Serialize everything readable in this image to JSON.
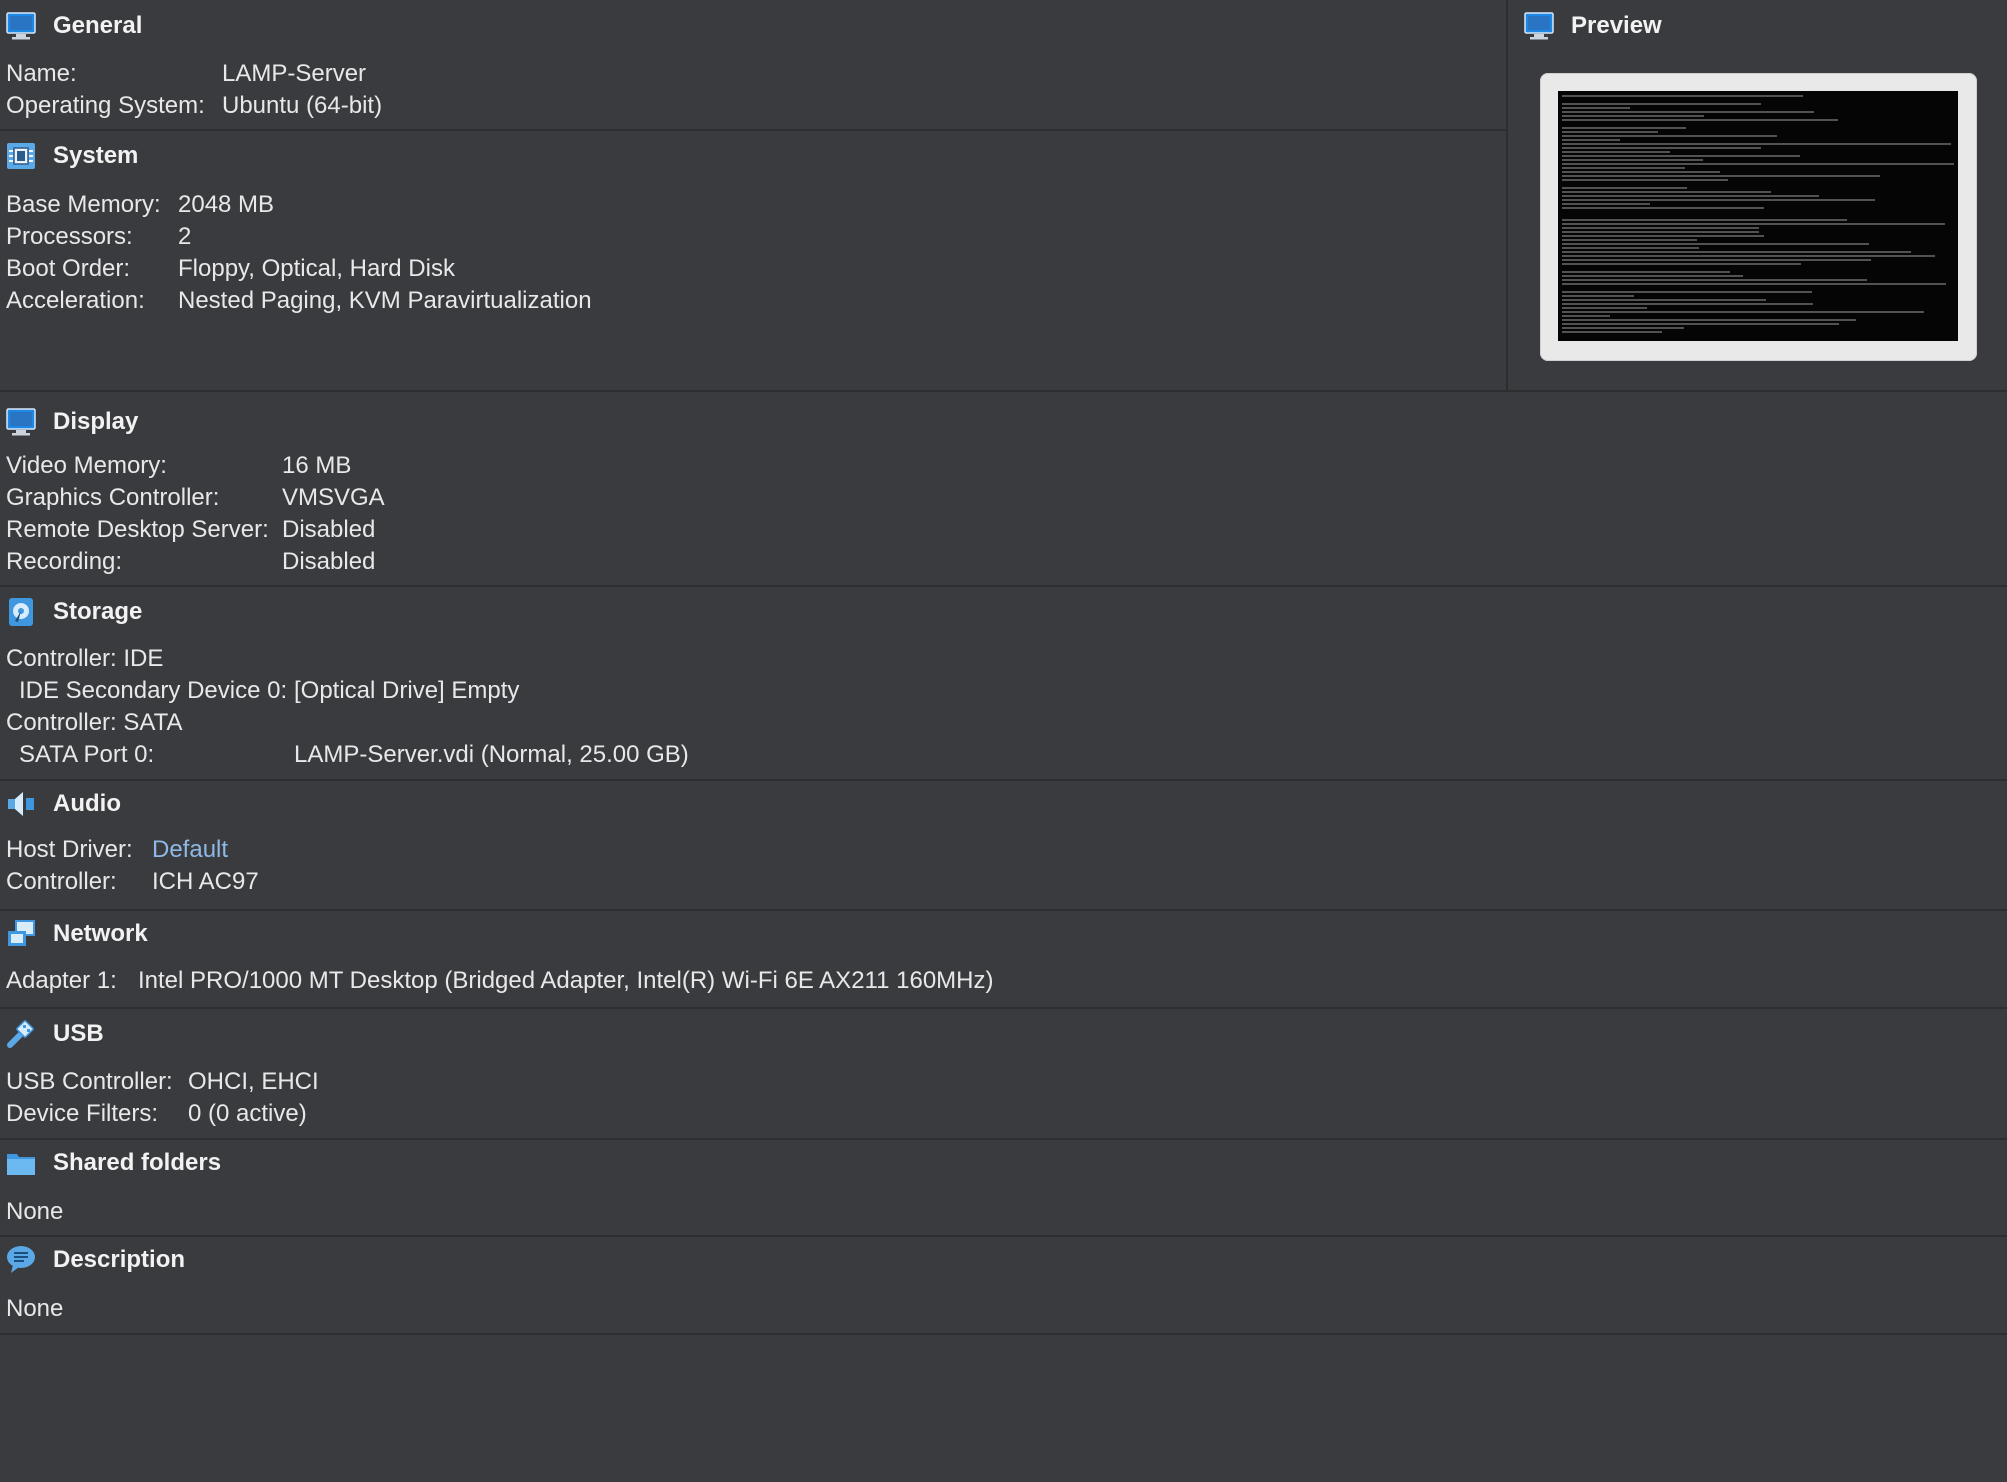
{
  "colors": {
    "background": "#3a3b3e",
    "divider": "#2d2e30",
    "text": "#e8e8e8",
    "link": "#8fb8e6",
    "icon_blue": "#1e88e5"
  },
  "general": {
    "title": "General",
    "icon": "monitor-icon",
    "name_label": "Name:",
    "name_value": "LAMP-Server",
    "os_label": "Operating System:",
    "os_value": "Ubuntu (64-bit)"
  },
  "preview": {
    "title": "Preview",
    "icon": "monitor-icon"
  },
  "system": {
    "title": "System",
    "icon": "chip-icon",
    "rows": [
      {
        "label": "Base Memory:",
        "value": "2048 MB"
      },
      {
        "label": "Processors:",
        "value": "2"
      },
      {
        "label": "Boot Order:",
        "value": "Floppy, Optical, Hard Disk"
      },
      {
        "label": "Acceleration:",
        "value": "Nested Paging, KVM Paravirtualization"
      }
    ]
  },
  "display": {
    "title": "Display",
    "icon": "monitor-icon",
    "rows": [
      {
        "label": "Video Memory:",
        "value": "16 MB"
      },
      {
        "label": "Graphics Controller:",
        "value": "VMSVGA"
      },
      {
        "label": "Remote Desktop Server:",
        "value": "Disabled"
      },
      {
        "label": "Recording:",
        "value": "Disabled"
      }
    ]
  },
  "storage": {
    "title": "Storage",
    "icon": "disk-icon",
    "rows": [
      {
        "label": "Controller: IDE",
        "value": ""
      },
      {
        "label": "IDE Secondary Device 0:",
        "value": "[Optical Drive] Empty"
      },
      {
        "label": "Controller: SATA",
        "value": ""
      },
      {
        "label": "SATA Port 0:",
        "value": "LAMP-Server.vdi (Normal, 25.00 GB)"
      }
    ]
  },
  "audio": {
    "title": "Audio",
    "icon": "speaker-icon",
    "rows": [
      {
        "label": "Host Driver:",
        "value": "Default"
      },
      {
        "label": "Controller:",
        "value": "ICH AC97"
      }
    ]
  },
  "network": {
    "title": "Network",
    "icon": "network-icon",
    "rows": [
      {
        "label": "Adapter 1:",
        "value": "Intel PRO/1000 MT Desktop (Bridged Adapter, Intel(R) Wi-Fi 6E AX211 160MHz)"
      }
    ]
  },
  "usb": {
    "title": "USB",
    "icon": "usb-icon",
    "rows": [
      {
        "label": "USB Controller:",
        "value": "OHCI, EHCI"
      },
      {
        "label": "Device Filters:",
        "value": "0 (0 active)"
      }
    ]
  },
  "shared_folders": {
    "title": "Shared folders",
    "icon": "folder-icon",
    "value": "None"
  },
  "description": {
    "title": "Description",
    "icon": "speech-bubble-icon",
    "value": "None"
  }
}
